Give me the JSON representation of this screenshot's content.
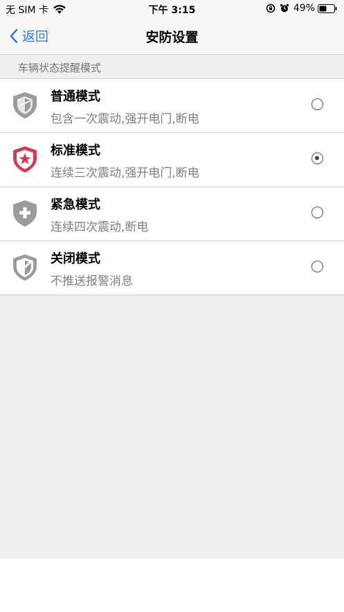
{
  "status_bar": {
    "carrier": "无 SIM 卡",
    "time": "下午 3:15",
    "battery": "49%"
  },
  "nav": {
    "back_label": "返回",
    "title": "安防设置"
  },
  "section": {
    "header": "车辆状态提醒模式"
  },
  "modes": [
    {
      "title": "普通模式",
      "subtitle": "包含一次震动,强开电门,断电",
      "icon": "shield-grey-icon",
      "selected": false
    },
    {
      "title": "标准模式",
      "subtitle": "连续三次震动,强开电门,断电",
      "icon": "shield-star-red-icon",
      "selected": true
    },
    {
      "title": "紧急模式",
      "subtitle": "连续四次震动,断电",
      "icon": "shield-plus-grey-icon",
      "selected": false
    },
    {
      "title": "关闭模式",
      "subtitle": "不推送报警消息",
      "icon": "shield-slash-grey-icon",
      "selected": false
    }
  ],
  "colors": {
    "accent": "#3478f6",
    "red_icon": "#d6394d",
    "grey_icon": "#9b9b9b"
  }
}
